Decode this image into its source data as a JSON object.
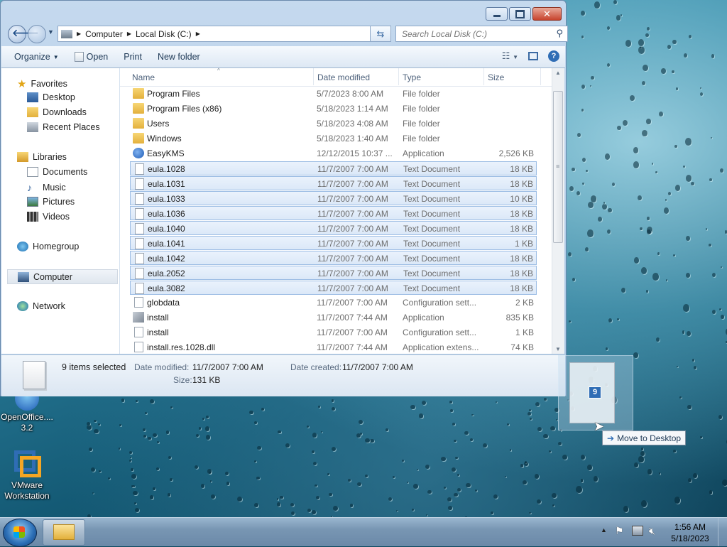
{
  "window": {
    "address": {
      "crumbs": [
        "Computer",
        "Local Disk (C:)"
      ]
    },
    "search_placeholder": "Search Local Disk (C:)",
    "toolbar": {
      "organize": "Organize",
      "open": "Open",
      "print": "Print",
      "new_folder": "New folder"
    },
    "nav": {
      "favorites": "Favorites",
      "desktop": "Desktop",
      "downloads": "Downloads",
      "recent_places": "Recent Places",
      "libraries": "Libraries",
      "documents": "Documents",
      "music": "Music",
      "pictures": "Pictures",
      "videos": "Videos",
      "homegroup": "Homegroup",
      "computer": "Computer",
      "network": "Network"
    },
    "columns": {
      "name": "Name",
      "date": "Date modified",
      "type": "Type",
      "size": "Size"
    },
    "files": [
      {
        "name": "Program Files",
        "date": "5/7/2023 8:00 AM",
        "type": "File folder",
        "size": "",
        "icon": "folder",
        "selected": false
      },
      {
        "name": "Program Files (x86)",
        "date": "5/18/2023 1:14 AM",
        "type": "File folder",
        "size": "",
        "icon": "folder",
        "selected": false
      },
      {
        "name": "Users",
        "date": "5/18/2023 4:08 AM",
        "type": "File folder",
        "size": "",
        "icon": "folder",
        "selected": false
      },
      {
        "name": "Windows",
        "date": "5/18/2023 1:40 AM",
        "type": "File folder",
        "size": "",
        "icon": "folder",
        "selected": false
      },
      {
        "name": "EasyKMS",
        "date": "12/12/2015 10:37 ...",
        "type": "Application",
        "size": "2,526 KB",
        "icon": "app",
        "selected": false
      },
      {
        "name": "eula.1028",
        "date": "11/7/2007 7:00 AM",
        "type": "Text Document",
        "size": "18 KB",
        "icon": "doc",
        "selected": true
      },
      {
        "name": "eula.1031",
        "date": "11/7/2007 7:00 AM",
        "type": "Text Document",
        "size": "18 KB",
        "icon": "doc",
        "selected": true
      },
      {
        "name": "eula.1033",
        "date": "11/7/2007 7:00 AM",
        "type": "Text Document",
        "size": "10 KB",
        "icon": "doc",
        "selected": true
      },
      {
        "name": "eula.1036",
        "date": "11/7/2007 7:00 AM",
        "type": "Text Document",
        "size": "18 KB",
        "icon": "doc",
        "selected": true
      },
      {
        "name": "eula.1040",
        "date": "11/7/2007 7:00 AM",
        "type": "Text Document",
        "size": "18 KB",
        "icon": "doc",
        "selected": true
      },
      {
        "name": "eula.1041",
        "date": "11/7/2007 7:00 AM",
        "type": "Text Document",
        "size": "1 KB",
        "icon": "doc",
        "selected": true
      },
      {
        "name": "eula.1042",
        "date": "11/7/2007 7:00 AM",
        "type": "Text Document",
        "size": "18 KB",
        "icon": "doc",
        "selected": true
      },
      {
        "name": "eula.2052",
        "date": "11/7/2007 7:00 AM",
        "type": "Text Document",
        "size": "18 KB",
        "icon": "doc",
        "selected": true
      },
      {
        "name": "eula.3082",
        "date": "11/7/2007 7:00 AM",
        "type": "Text Document",
        "size": "18 KB",
        "icon": "doc",
        "selected": true
      },
      {
        "name": "globdata",
        "date": "11/7/2007 7:00 AM",
        "type": "Configuration sett...",
        "size": "2 KB",
        "icon": "config",
        "selected": false
      },
      {
        "name": "install",
        "date": "11/7/2007 7:44 AM",
        "type": "Application",
        "size": "835 KB",
        "icon": "installer",
        "selected": false
      },
      {
        "name": "install",
        "date": "11/7/2007 7:00 AM",
        "type": "Configuration sett...",
        "size": "1 KB",
        "icon": "config",
        "selected": false
      },
      {
        "name": "install.res.1028.dll",
        "date": "11/7/2007 7:44 AM",
        "type": "Application extens...",
        "size": "74 KB",
        "icon": "dll",
        "selected": false
      }
    ],
    "details": {
      "summary": "9 items selected",
      "date_modified_label": "Date modified:",
      "date_modified": "11/7/2007 7:00 AM",
      "date_created_label": "Date created:",
      "date_created": "11/7/2007 7:00 AM",
      "size_label": "Size:",
      "size": "131 KB"
    }
  },
  "drag": {
    "count": "9",
    "tooltip": "Move to Desktop"
  },
  "desktop_icons": [
    {
      "label_line1": "OpenOffice....",
      "label_line2": "3.2"
    },
    {
      "label_line1": "VMware",
      "label_line2": "Workstation"
    }
  ],
  "taskbar": {
    "time": "1:56 AM",
    "date": "5/18/2023"
  },
  "colors": {
    "selection_bg": "#dbe8f8",
    "selection_border": "#9dbde4",
    "accent": "#2f6db5"
  }
}
